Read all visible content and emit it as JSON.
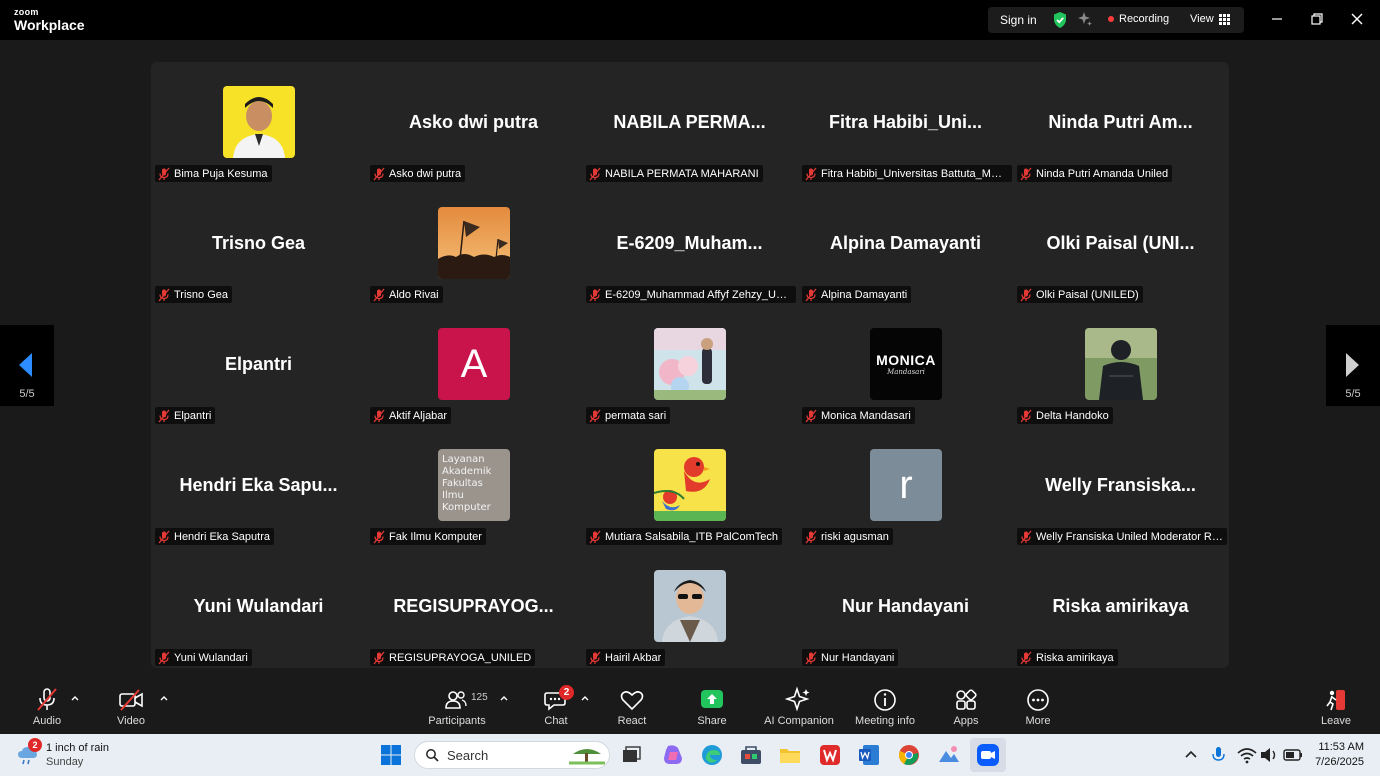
{
  "app": {
    "logo_top": "zoom",
    "logo_bottom": "Workplace"
  },
  "titlebar": {
    "signin": "Sign in",
    "recording": "Recording",
    "view": "View"
  },
  "pager": {
    "left": "5/5",
    "right": "5/5"
  },
  "participants_grid": [
    {
      "display": "photo",
      "big": "",
      "name": "Bima Puja Kesuma"
    },
    {
      "display": "name",
      "big": "Asko dwi putra",
      "name": "Asko dwi putra"
    },
    {
      "display": "name",
      "big": "NABILA PERMA...",
      "name": "NABILA PERMATA MAHARANI"
    },
    {
      "display": "name",
      "big": "Fitra Habibi_Uni...",
      "name": "Fitra Habibi_Universitas Battuta_Med..."
    },
    {
      "display": "name",
      "big": "Ninda Putri Am...",
      "name": "Ninda Putri Amanda Uniled"
    },
    {
      "display": "name",
      "big": "Trisno Gea",
      "name": "Trisno Gea"
    },
    {
      "display": "photo",
      "big": "",
      "name": "Aldo Rivai"
    },
    {
      "display": "name",
      "big": "E-6209_Muham...",
      "name": "E-6209_Muhammad Affyf Zehzy_Unil..."
    },
    {
      "display": "name",
      "big": "Alpina Damayanti",
      "name": "Alpina Damayanti"
    },
    {
      "display": "name",
      "big": "Olki Paisal (UNI...",
      "name": "Olki Paisal (UNILED)"
    },
    {
      "display": "name",
      "big": "Elpantri",
      "name": "Elpantri"
    },
    {
      "display": "photo",
      "big": "",
      "name": "Aktif Aljabar"
    },
    {
      "display": "photo",
      "big": "",
      "name": "permata sari"
    },
    {
      "display": "photo",
      "big": "",
      "name": "Monica Mandasari"
    },
    {
      "display": "photo",
      "big": "",
      "name": "Delta Handoko"
    },
    {
      "display": "name",
      "big": "Hendri Eka Sapu...",
      "name": "Hendri Eka Saputra"
    },
    {
      "display": "photo",
      "big": "",
      "name": "Fak Ilmu Komputer"
    },
    {
      "display": "photo",
      "big": "",
      "name": "Mutiara Salsabila_ITB PalComTech"
    },
    {
      "display": "photo",
      "big": "",
      "name": "riski agusman"
    },
    {
      "display": "name",
      "big": "Welly Fransiska...",
      "name": "Welly Fransiska Uniled Moderator Ro..."
    },
    {
      "display": "name",
      "big": "Yuni Wulandari",
      "name": "Yuni Wulandari"
    },
    {
      "display": "name",
      "big": "REGISUPRAYOG...",
      "name": "REGISUPRAYOGA_UNILED"
    },
    {
      "display": "photo",
      "big": "",
      "name": "Hairil Akbar"
    },
    {
      "display": "name",
      "big": "Nur Handayani",
      "name": "Nur Handayani"
    },
    {
      "display": "name",
      "big": "Riska amirikaya",
      "name": "Riska amirikaya"
    }
  ],
  "avatars": {
    "aktif": "A",
    "riski": "r",
    "monica_title": "MONICA",
    "monica_sub": "Mandasari",
    "fak": "Layanan Akademik Fakultas Ilmu Komputer"
  },
  "toolbar": {
    "audio": "Audio",
    "video": "Video",
    "participants": "Participants",
    "participants_count": "125",
    "chat": "Chat",
    "chat_badge": "2",
    "react": "React",
    "share": "Share",
    "ai": "AI Companion",
    "info": "Meeting info",
    "apps": "Apps",
    "more": "More",
    "leave": "Leave"
  },
  "taskbar": {
    "weather_badge": "2",
    "weather_line1": "1 inch of rain",
    "weather_line2": "Sunday",
    "search": "Search",
    "time": "11:53 AM",
    "date": "7/26/2025"
  },
  "colors": {
    "accent_share": "#21c45d",
    "muted_red": "#e53935",
    "recording_dot": "#ff3b3b",
    "page_arrow": "#2d8cff"
  }
}
